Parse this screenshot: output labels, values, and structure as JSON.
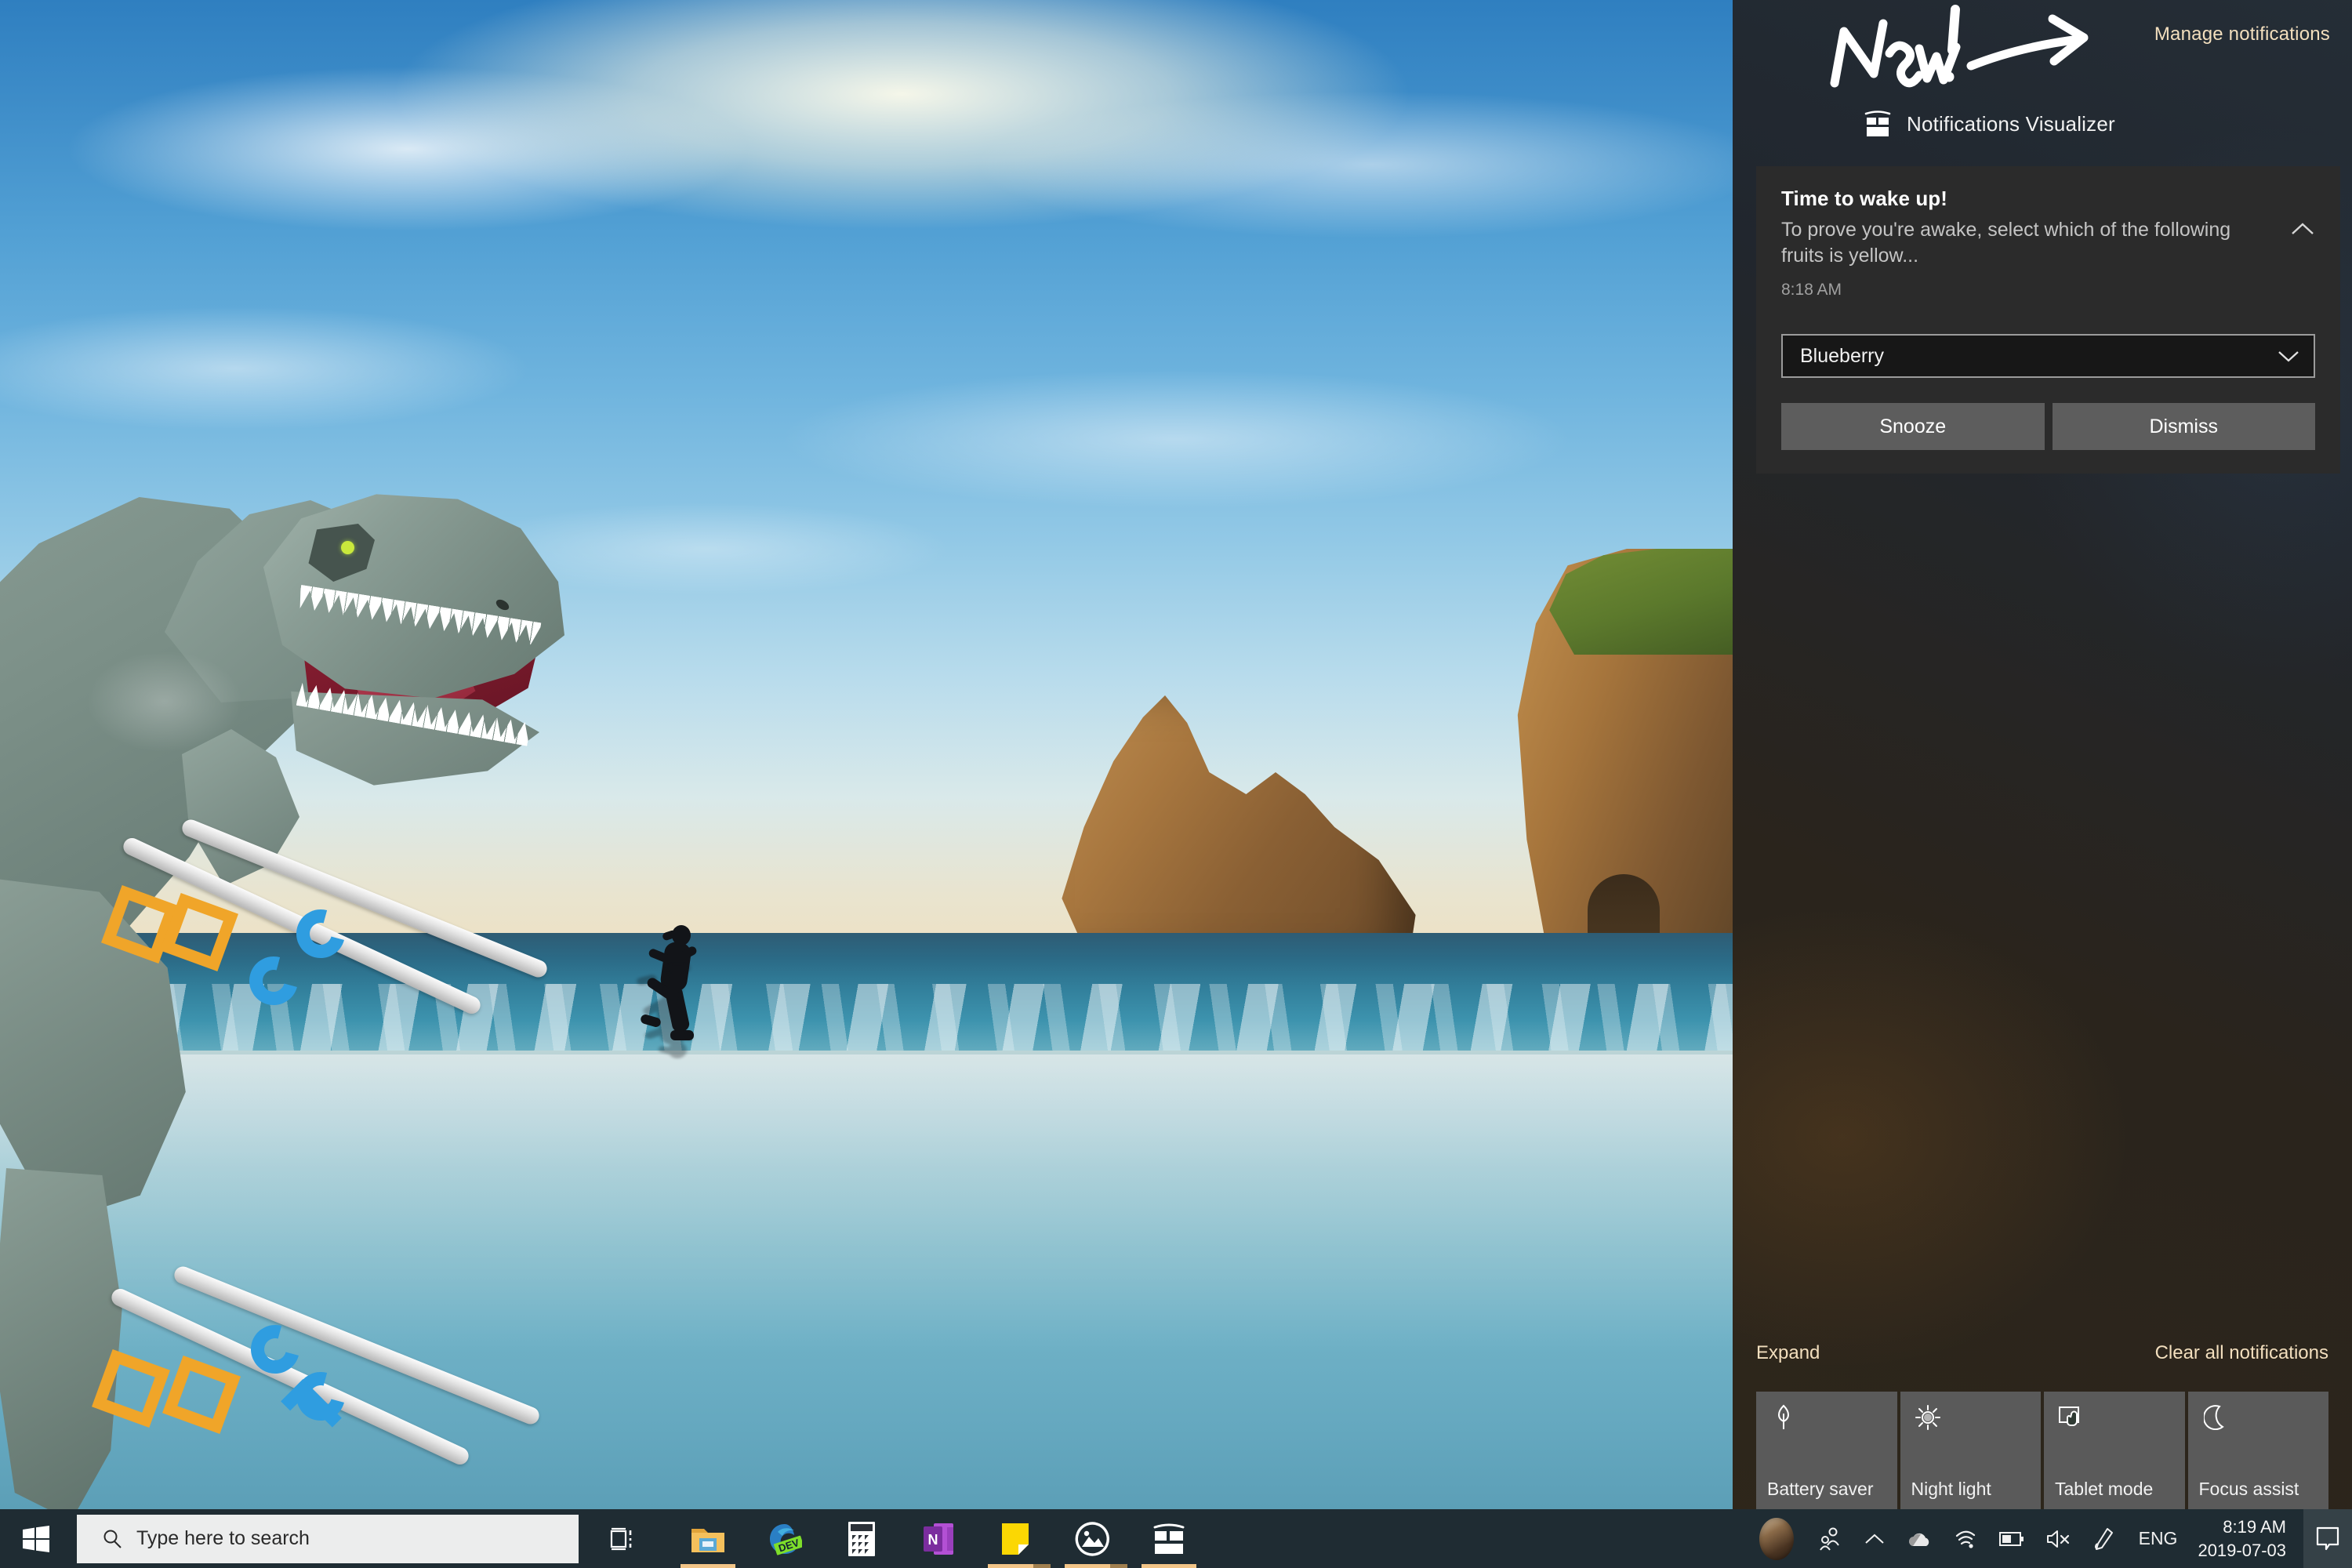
{
  "action_center": {
    "scribble_text": "New!",
    "scribble_icon": "handwritten-new-arrow",
    "manage_notifications_label": "Manage notifications",
    "app": {
      "icon": "notifications-visualizer-icon",
      "name": "Notifications Visualizer"
    },
    "notification": {
      "title": "Time to wake up!",
      "body": "To prove you're awake, select which of the following fruits is yellow...",
      "time": "8:18 AM",
      "collapse_icon": "chevron-up-icon",
      "select": {
        "value": "Blueberry",
        "chevron_icon": "chevron-down-icon"
      },
      "actions": [
        {
          "label": "Snooze",
          "name": "snooze-button"
        },
        {
          "label": "Dismiss",
          "name": "dismiss-button"
        }
      ]
    },
    "footer": {
      "expand_label": "Expand",
      "clear_all_label": "Clear all notifications"
    },
    "quick_actions": [
      {
        "label": "Battery saver",
        "icon": "leaf-icon"
      },
      {
        "label": "Night light",
        "icon": "sun-icon"
      },
      {
        "label": "Tablet mode",
        "icon": "tablet-touch-icon"
      },
      {
        "label": "Focus assist",
        "icon": "moon-icon"
      }
    ],
    "colors": {
      "panel_bg": "#2a323a",
      "card_bg": "#2b2b2b",
      "button_bg": "#5d5d5d",
      "select_bg": "#171717",
      "link_accent": "#f3dfbe",
      "tile_bg": "#5a5a5a"
    }
  },
  "desktop": {
    "wallpaper_name": "beach-cliffs-wallpaper",
    "overlay_name": "t-rex-with-ski-poles-overlay"
  },
  "taskbar": {
    "start_icon": "windows-start-icon",
    "search": {
      "placeholder": "Type here to search",
      "icon": "search-icon"
    },
    "task_view_icon": "task-view-icon",
    "apps": [
      {
        "name": "file-explorer",
        "icon": "folder-icon",
        "running": true
      },
      {
        "name": "edge-dev",
        "icon": "edge-dev-icon",
        "running": false
      },
      {
        "name": "calculator",
        "icon": "calculator-icon",
        "running": false
      },
      {
        "name": "onenote",
        "icon": "onenote-icon",
        "running": false
      },
      {
        "name": "sticky-notes",
        "icon": "sticky-notes-icon",
        "running": true
      },
      {
        "name": "photos",
        "icon": "photos-icon",
        "running": true
      },
      {
        "name": "notifications-visualizer",
        "icon": "notifications-visualizer-icon",
        "running": true
      }
    ],
    "tray": {
      "avatar": "user-avatar",
      "items": [
        {
          "name": "people-icon",
          "icon": "people-icon"
        },
        {
          "name": "show-hidden-icons",
          "icon": "chevron-up-icon"
        },
        {
          "name": "onedrive-icon",
          "icon": "onedrive-cloud-icon"
        },
        {
          "name": "network-icon",
          "icon": "wifi-icon"
        },
        {
          "name": "battery-icon",
          "icon": "battery-icon"
        },
        {
          "name": "volume-icon",
          "icon": "volume-muted-icon"
        },
        {
          "name": "pen-workspace-icon",
          "icon": "pen-icon"
        }
      ],
      "language": "ENG",
      "clock": {
        "time": "8:19 AM",
        "date": "2019-07-03"
      },
      "action_center_icon": "action-center-icon"
    },
    "colors": {
      "bg": "#1f2c33",
      "indicator": "#f2c487"
    }
  }
}
